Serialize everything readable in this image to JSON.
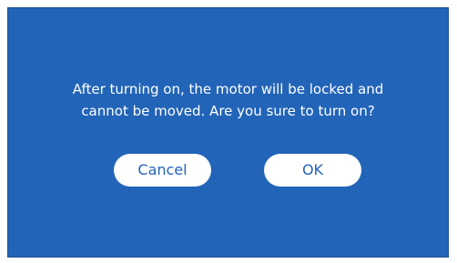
{
  "dialog": {
    "message_line1": "After turning on, the motor will be locked and",
    "message_line2": "cannot be moved. Are you sure to turn on?",
    "cancel_label": "Cancel",
    "ok_label": "OK"
  },
  "colors": {
    "dialog_background": "#2264B8",
    "button_background": "#FFFFFF",
    "button_text": "#2264B8",
    "message_text": "#FFFFFF"
  }
}
